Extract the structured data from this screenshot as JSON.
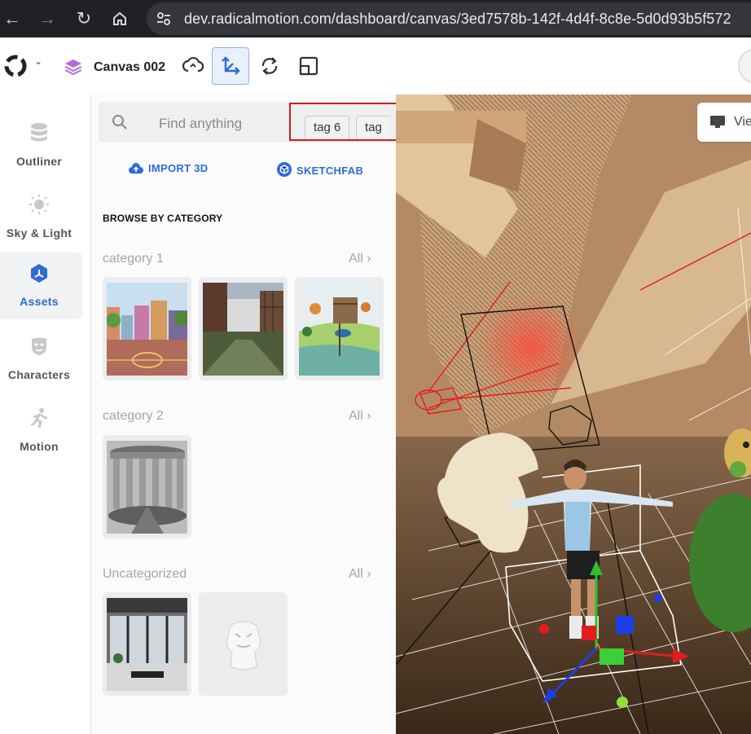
{
  "browser": {
    "url": "dev.radicalmotion.com/dashboard/canvas/3ed7578b-142f-4d4f-8c8e-5d0d93b5f572"
  },
  "header": {
    "canvas_name": "Canvas 002"
  },
  "rail": {
    "items": [
      {
        "label": "Outliner",
        "icon": "database-icon"
      },
      {
        "label": "Sky & Light",
        "icon": "sun-icon"
      },
      {
        "label": "Assets",
        "icon": "cube-icon",
        "active": true
      },
      {
        "label": "Characters",
        "icon": "mask-icon"
      },
      {
        "label": "Motion",
        "icon": "running-icon"
      }
    ]
  },
  "search": {
    "placeholder": "Find anything",
    "tags": [
      "tag 6",
      "tag"
    ]
  },
  "actions": {
    "import_label": "IMPORT 3D",
    "sketchfab_label": "SKETCHFAB"
  },
  "browse_heading": "BROWSE BY CATEGORY",
  "categories": [
    {
      "title": "category 1",
      "all_label": "All",
      "items": [
        "city-street",
        "industrial-alley",
        "island-village"
      ]
    },
    {
      "title": "category 2",
      "all_label": "All",
      "items": [
        "colonnade"
      ]
    },
    {
      "title": "Uncategorized",
      "all_label": "All",
      "items": [
        "interior-room",
        "white-figure"
      ]
    }
  ],
  "viewport": {
    "view_button_label": "Vie"
  },
  "colors": {
    "accent": "#2d6bd6",
    "highlight": "#d61a1a",
    "browser_bar": "#202124"
  }
}
